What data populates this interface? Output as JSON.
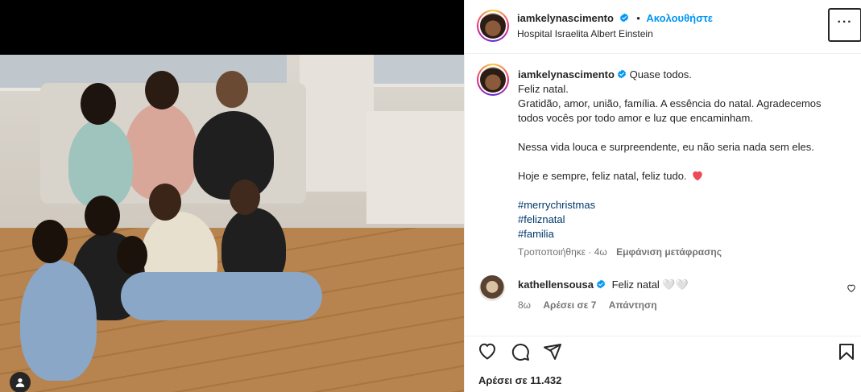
{
  "post": {
    "username": "iamkelynascimento",
    "follow_label": "Ακολουθήστε",
    "location": "Hospital Israelita Albert Einstein",
    "more_label": "···"
  },
  "caption": {
    "username": "iamkelynascimento",
    "line1": "Quase todos.",
    "line2": "Feliz natal.",
    "line3": "Gratidão, amor, união, família. A essência do natal. Agradecemos todos vocês por todo amor e luz que encaminham.",
    "line4": "Nessa vida louca e surpreendente, eu não seria nada sem eles.",
    "line5": "Hoje e sempre, feliz natal, feliz tudo.",
    "hashtags": [
      "#merrychristmas",
      "#feliznatal",
      "#familia"
    ],
    "edited_label": "Τροποποιήθηκε · 4ω",
    "translate_label": "Εμφάνιση μετάφρασης"
  },
  "comment": {
    "username": "kathellensousa",
    "text": "Feliz natal 🤍🤍",
    "time": "8ω",
    "likes": "Αρέσει σε 7",
    "reply": "Απάντηση"
  },
  "footer": {
    "likes": "Αρέσει σε 11.432"
  },
  "icons": {
    "verified": "verified-badge-icon",
    "heart_emoji": "red-heart-icon",
    "like": "heart-outline-icon",
    "comment": "comment-icon",
    "share": "share-icon",
    "save": "bookmark-icon",
    "user_tag": "user-tag-icon"
  },
  "colors": {
    "accent_blue": "#0095f6",
    "hashtag": "#00376b",
    "verified": "#0095f6",
    "heart": "#ed4956"
  }
}
